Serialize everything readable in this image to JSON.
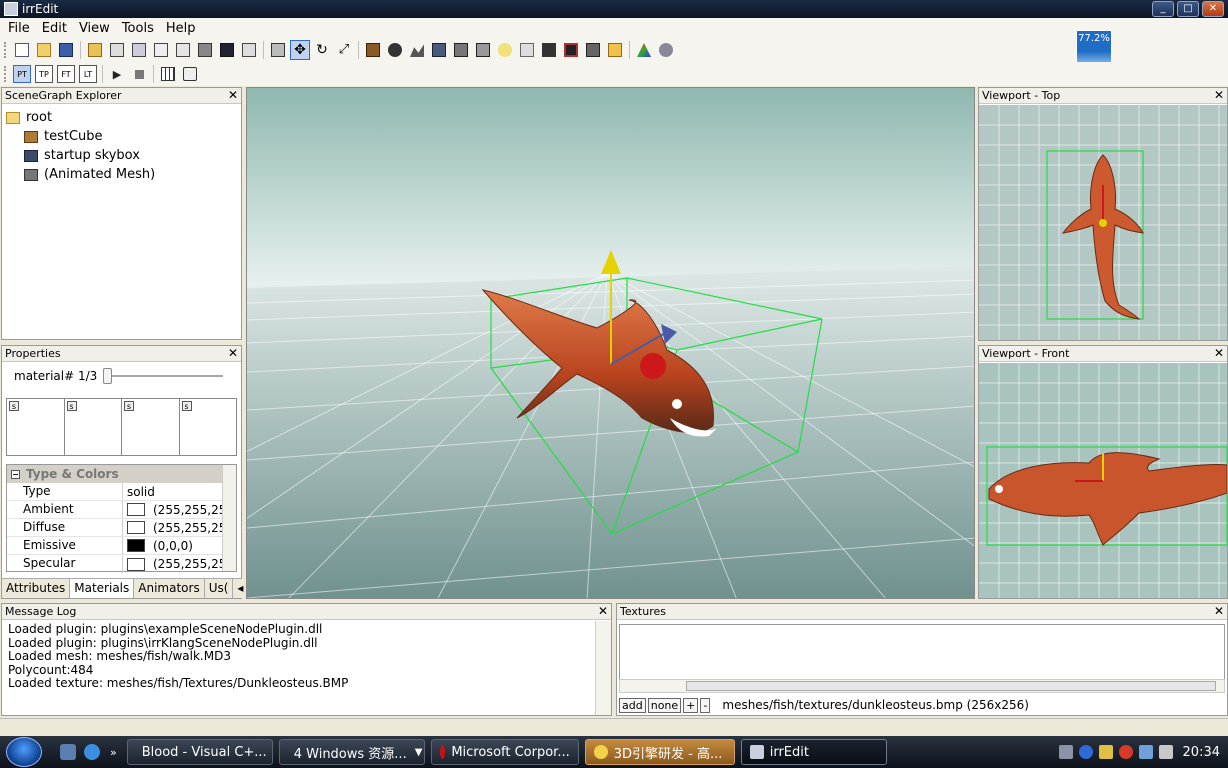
{
  "window": {
    "title": "irrEdit"
  },
  "menu": [
    "File",
    "Edit",
    "View",
    "Tools",
    "Help"
  ],
  "toolbar2": {
    "view_buttons": [
      "PT",
      "TP",
      "FT",
      "LT"
    ]
  },
  "fps": {
    "value": "77.2%"
  },
  "scene_graph": {
    "title": "SceneGraph Explorer",
    "root": "root",
    "children": [
      "testCube",
      "startup skybox",
      "(Animated Mesh)"
    ]
  },
  "properties": {
    "title": "Properties",
    "material_label": "material# 1/3",
    "slot_labels": [
      "s",
      "s",
      "s",
      "s"
    ],
    "section": "Type & Colors",
    "rows": [
      {
        "key": "Type",
        "value": "solid"
      },
      {
        "key": "Ambient",
        "value": "(255,255,25",
        "color": "#ffffff"
      },
      {
        "key": "Diffuse",
        "value": "(255,255,25",
        "color": "#ffffff"
      },
      {
        "key": "Emissive",
        "value": "(0,0,0)",
        "color": "#000000"
      },
      {
        "key": "Specular",
        "value": "(255,255,25",
        "color": "#ffffff"
      }
    ],
    "tabs": [
      "Attributes",
      "Materials",
      "Animators",
      "Us("
    ]
  },
  "viewport_top": {
    "title": "Viewport - Top"
  },
  "viewport_front": {
    "title": "Viewport - Front"
  },
  "message_log": {
    "title": "Message Log",
    "lines": [
      "Loaded plugin: plugins\\exampleSceneNodePlugin.dll",
      "Loaded plugin: plugins\\irrKlangSceneNodePlugin.dll",
      "Loaded mesh: meshes/fish/walk.MD3",
      "Polycount:484",
      "Loaded texture: meshes/fish/Textures/Dunkleosteus.BMP"
    ]
  },
  "textures": {
    "title": "Textures",
    "buttons": [
      "add",
      "none",
      "+",
      "-"
    ],
    "current": "meshes/fish/textures/dunkleosteus.bmp (256x256)"
  },
  "taskbar": {
    "buttons": [
      "Blood - Visual C+...",
      "4 Windows 资源...",
      "Microsoft Corpor...",
      "3D引擎研发 - 高...",
      "irrEdit"
    ],
    "clock": "20:34"
  },
  "colors": {
    "accent": "#316ac5",
    "fish": "#c8552c",
    "bbox": "#22dd44"
  }
}
